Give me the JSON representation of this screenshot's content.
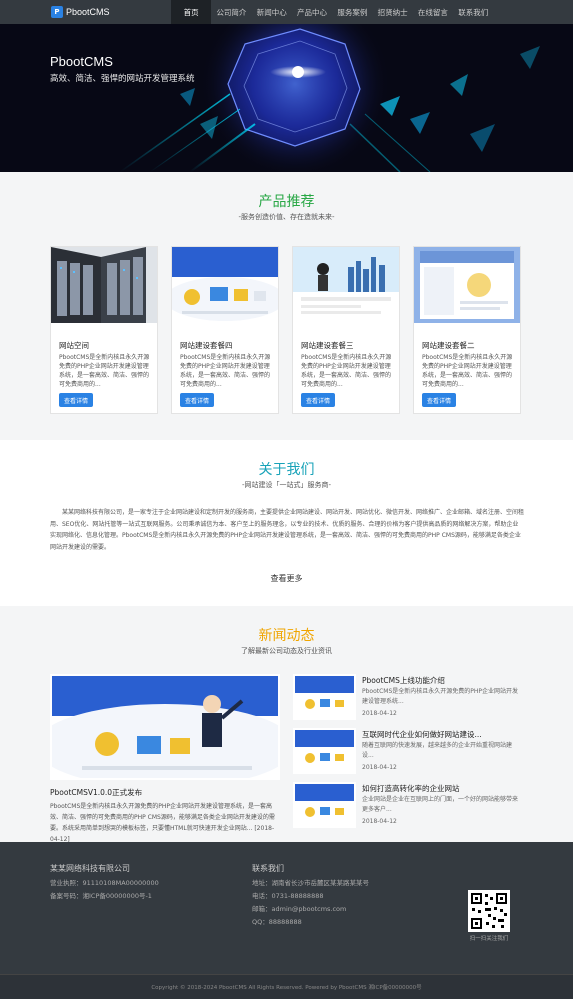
{
  "nav": {
    "brand": "PbootCMS",
    "logo_glyph": "P",
    "items": [
      "首页",
      "公司简介",
      "新闻中心",
      "产品中心",
      "服务案例",
      "招贤纳士",
      "在线留言",
      "联系我们"
    ]
  },
  "banner": {
    "title": "PbootCMS",
    "subtitle": "高效、简洁、强悍的网站开发管理系统"
  },
  "products": {
    "title": "产品推荐",
    "subtitle": "-服务创造价值、存在造就未来-",
    "cards": [
      {
        "title": "网站空间",
        "text": "PbootCMS是全新内核且永久开源免费的PHP企业网站开发建设管理系统，是一套高效、简洁、强悍的可免费商用的...",
        "button": "查看详情"
      },
      {
        "title": "网站建设套餐四",
        "text": "PbootCMS是全新内核且永久开源免费的PHP企业网站开发建设管理系统，是一套高效、简洁、强悍的可免费商用的...",
        "button": "查看详情"
      },
      {
        "title": "网站建设套餐三",
        "text": "PbootCMS是全新内核且永久开源免费的PHP企业网站开发建设管理系统，是一套高效、简洁、强悍的可免费商用的...",
        "button": "查看详情"
      },
      {
        "title": "网站建设套餐二",
        "text": "PbootCMS是全新内核且永久开源免费的PHP企业网站开发建设管理系统，是一套高效、简洁、强悍的可免费商用的...",
        "button": "查看详情"
      }
    ]
  },
  "about": {
    "title": "关于我们",
    "subtitle": "-网站建设「一站式」服务商-",
    "text": "某某网络科技有限公司，是一家专注于企业网站建设和定制开发的服务商，主要提供企业网站建设、网站开发、网站优化、微信开发、网络推广、企业邮箱、域名注册、空间租用、SEO优化、网站托管等一站式互联网服务。公司秉承诚信为本、客户至上的服务理念，以专业的技术、优质的服务、合理的价格为客户提供高品质的网络解决方案，帮助企业实现网络化、信息化管理。PbootCMS是全新内核且永久开源免费的PHP企业网站开发建设管理系统，是一套高效、简洁、强悍的可免费商用的PHP CMS源码，能够满足各类企业网站开发建设的需要。",
    "more": "查看更多"
  },
  "news": {
    "title": "新闻动态",
    "subtitle": "了解最新公司动态及行业资讯",
    "main": {
      "title": "PbootCMSV1.0.0正式发布",
      "text": "PbootCMS是全新内核且永久开源免费的PHP企业网站开发建设管理系统，是一套高效、简洁、强悍的可免费商用的PHP CMS源码，能够满足各类企业网站开发建设的需要。系统采用简单到想哭的模板标签，只要懂HTML就可快速开发企业网站...",
      "date": "[2018-04-12]"
    },
    "items": [
      {
        "title": "PbootCMS上线功能介绍",
        "text": "PbootCMS是全新内核且永久开源免费的PHP企业网站开发建设管理系统...",
        "date": "2018-04-12"
      },
      {
        "title": "互联网时代企业如何做好网站建设...",
        "text": "随着互联网的快速发展，越来越多的企业开始重视网站建设...",
        "date": "2018-04-12"
      },
      {
        "title": "如何打造高转化率的企业网站",
        "text": "企业网站是企业在互联网上的门面，一个好的网站能够带来更多客户...",
        "date": "2018-04-12"
      }
    ]
  },
  "footer": {
    "company": "某某网络科技有限公司",
    "company_lines": [
      "营业执照：91110108MA00000000",
      "备案号码：湘ICP备00000000号-1"
    ],
    "contact_title": "联系我们",
    "contact_lines": [
      "地址：湖南省长沙市岳麓区某某路某某号",
      "电话：0731-88888888",
      "邮箱：admin@pbootcms.com",
      "QQ：88888888"
    ],
    "qr_label": "扫一扫关注我们",
    "copyright": "Copyright © 2018-2024 PbootCMS All Rights Reserved. Powered by PbootCMS 湘ICP备00000000号"
  },
  "colors": {
    "nav_bg": "#343a40",
    "primary": "#2a82e4",
    "green_title": "#28a745",
    "teal_title": "#17a2b8",
    "orange_title": "#f0a500"
  }
}
